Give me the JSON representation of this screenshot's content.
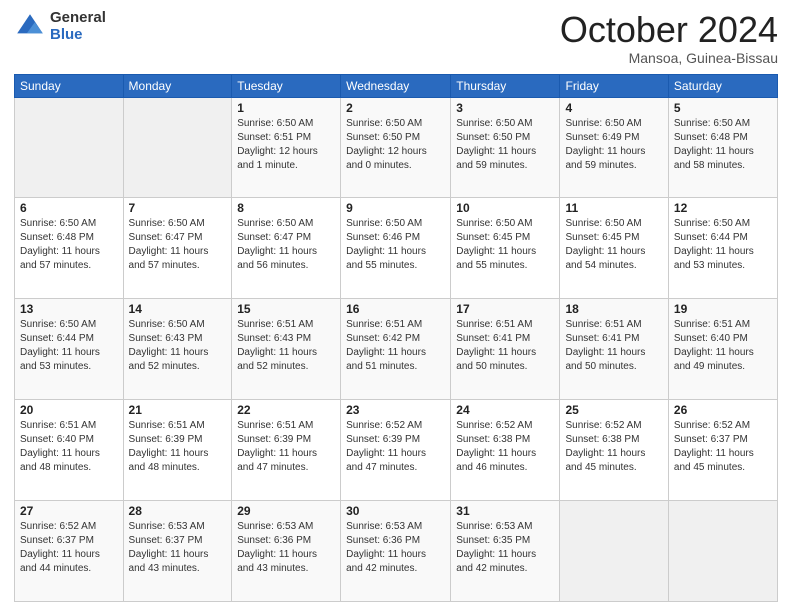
{
  "header": {
    "logo_general": "General",
    "logo_blue": "Blue",
    "month_title": "October 2024",
    "location": "Mansoa, Guinea-Bissau"
  },
  "days_of_week": [
    "Sunday",
    "Monday",
    "Tuesday",
    "Wednesday",
    "Thursday",
    "Friday",
    "Saturday"
  ],
  "weeks": [
    [
      {
        "day": "",
        "empty": true
      },
      {
        "day": "",
        "empty": true
      },
      {
        "day": "1",
        "sunrise": "6:50 AM",
        "sunset": "6:51 PM",
        "daylight": "12 hours and 1 minute."
      },
      {
        "day": "2",
        "sunrise": "6:50 AM",
        "sunset": "6:50 PM",
        "daylight": "12 hours and 0 minutes."
      },
      {
        "day": "3",
        "sunrise": "6:50 AM",
        "sunset": "6:50 PM",
        "daylight": "11 hours and 59 minutes."
      },
      {
        "day": "4",
        "sunrise": "6:50 AM",
        "sunset": "6:49 PM",
        "daylight": "11 hours and 59 minutes."
      },
      {
        "day": "5",
        "sunrise": "6:50 AM",
        "sunset": "6:48 PM",
        "daylight": "11 hours and 58 minutes."
      }
    ],
    [
      {
        "day": "6",
        "sunrise": "6:50 AM",
        "sunset": "6:48 PM",
        "daylight": "11 hours and 57 minutes."
      },
      {
        "day": "7",
        "sunrise": "6:50 AM",
        "sunset": "6:47 PM",
        "daylight": "11 hours and 57 minutes."
      },
      {
        "day": "8",
        "sunrise": "6:50 AM",
        "sunset": "6:47 PM",
        "daylight": "11 hours and 56 minutes."
      },
      {
        "day": "9",
        "sunrise": "6:50 AM",
        "sunset": "6:46 PM",
        "daylight": "11 hours and 55 minutes."
      },
      {
        "day": "10",
        "sunrise": "6:50 AM",
        "sunset": "6:45 PM",
        "daylight": "11 hours and 55 minutes."
      },
      {
        "day": "11",
        "sunrise": "6:50 AM",
        "sunset": "6:45 PM",
        "daylight": "11 hours and 54 minutes."
      },
      {
        "day": "12",
        "sunrise": "6:50 AM",
        "sunset": "6:44 PM",
        "daylight": "11 hours and 53 minutes."
      }
    ],
    [
      {
        "day": "13",
        "sunrise": "6:50 AM",
        "sunset": "6:44 PM",
        "daylight": "11 hours and 53 minutes."
      },
      {
        "day": "14",
        "sunrise": "6:50 AM",
        "sunset": "6:43 PM",
        "daylight": "11 hours and 52 minutes."
      },
      {
        "day": "15",
        "sunrise": "6:51 AM",
        "sunset": "6:43 PM",
        "daylight": "11 hours and 52 minutes."
      },
      {
        "day": "16",
        "sunrise": "6:51 AM",
        "sunset": "6:42 PM",
        "daylight": "11 hours and 51 minutes."
      },
      {
        "day": "17",
        "sunrise": "6:51 AM",
        "sunset": "6:41 PM",
        "daylight": "11 hours and 50 minutes."
      },
      {
        "day": "18",
        "sunrise": "6:51 AM",
        "sunset": "6:41 PM",
        "daylight": "11 hours and 50 minutes."
      },
      {
        "day": "19",
        "sunrise": "6:51 AM",
        "sunset": "6:40 PM",
        "daylight": "11 hours and 49 minutes."
      }
    ],
    [
      {
        "day": "20",
        "sunrise": "6:51 AM",
        "sunset": "6:40 PM",
        "daylight": "11 hours and 48 minutes."
      },
      {
        "day": "21",
        "sunrise": "6:51 AM",
        "sunset": "6:39 PM",
        "daylight": "11 hours and 48 minutes."
      },
      {
        "day": "22",
        "sunrise": "6:51 AM",
        "sunset": "6:39 PM",
        "daylight": "11 hours and 47 minutes."
      },
      {
        "day": "23",
        "sunrise": "6:52 AM",
        "sunset": "6:39 PM",
        "daylight": "11 hours and 47 minutes."
      },
      {
        "day": "24",
        "sunrise": "6:52 AM",
        "sunset": "6:38 PM",
        "daylight": "11 hours and 46 minutes."
      },
      {
        "day": "25",
        "sunrise": "6:52 AM",
        "sunset": "6:38 PM",
        "daylight": "11 hours and 45 minutes."
      },
      {
        "day": "26",
        "sunrise": "6:52 AM",
        "sunset": "6:37 PM",
        "daylight": "11 hours and 45 minutes."
      }
    ],
    [
      {
        "day": "27",
        "sunrise": "6:52 AM",
        "sunset": "6:37 PM",
        "daylight": "11 hours and 44 minutes."
      },
      {
        "day": "28",
        "sunrise": "6:53 AM",
        "sunset": "6:37 PM",
        "daylight": "11 hours and 43 minutes."
      },
      {
        "day": "29",
        "sunrise": "6:53 AM",
        "sunset": "6:36 PM",
        "daylight": "11 hours and 43 minutes."
      },
      {
        "day": "30",
        "sunrise": "6:53 AM",
        "sunset": "6:36 PM",
        "daylight": "11 hours and 42 minutes."
      },
      {
        "day": "31",
        "sunrise": "6:53 AM",
        "sunset": "6:35 PM",
        "daylight": "11 hours and 42 minutes."
      },
      {
        "day": "",
        "empty": true
      },
      {
        "day": "",
        "empty": true
      }
    ]
  ]
}
